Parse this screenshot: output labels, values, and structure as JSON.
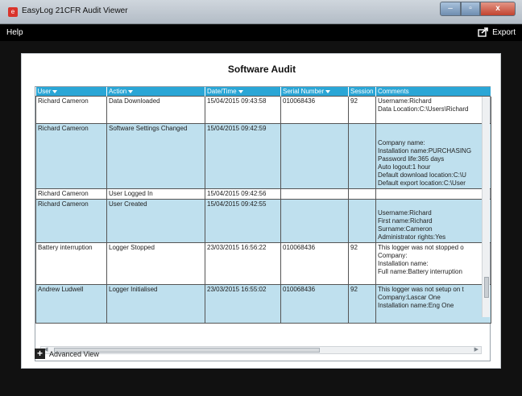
{
  "window": {
    "title": "EasyLog 21CFR Audit Viewer",
    "controls": {
      "minimize": "–",
      "maximize": "▫",
      "close": "x"
    }
  },
  "menu": {
    "help": "Help",
    "export": "Export"
  },
  "page": {
    "heading": "Software Audit",
    "advanced_view": "Advanced View"
  },
  "table": {
    "columns": [
      "User",
      "Action",
      "Date/Time",
      "Serial Number",
      "Session",
      "Comments"
    ],
    "rows": [
      {
        "highlight": false,
        "user": "Richard Cameron",
        "action": "Data Downloaded",
        "datetime": "15/04/2015 09:43:58",
        "serial": "010068436",
        "session": "92",
        "comments": [
          "Username:Richard",
          "Data Location:C:\\Users\\Richard"
        ]
      },
      {
        "highlight": true,
        "user": "Richard Cameron",
        "action": "Software Settings Changed",
        "datetime": "15/04/2015 09:42:59",
        "serial": "",
        "session": "",
        "comments": [
          "Company name:",
          "Installation name:PURCHASING",
          "Password life:365 days",
          "Auto logout:1 hour",
          "Default download location:C:\\U",
          "Default export location:C:\\User"
        ]
      },
      {
        "highlight": false,
        "user": "Richard Cameron",
        "action": "User Logged In",
        "datetime": "15/04/2015 09:42:56",
        "serial": "",
        "session": "",
        "comments": []
      },
      {
        "highlight": true,
        "user": "Richard Cameron",
        "action": "User Created",
        "datetime": "15/04/2015 09:42:55",
        "serial": "",
        "session": "",
        "comments": [
          "Username:Richard",
          "First name:Richard",
          "Surname:Cameron",
          "Administrator rights:Yes"
        ]
      },
      {
        "highlight": false,
        "user": "Battery interruption",
        "action": "Logger Stopped",
        "datetime": "23/03/2015 16:56:22",
        "serial": "010068436",
        "session": "92",
        "comments": [
          "This logger was not stopped o",
          "Company:",
          "Installation name:",
          "Full name:Battery interruption"
        ]
      },
      {
        "highlight": true,
        "user": "Andrew Ludwell",
        "action": "Logger Initialised",
        "datetime": "23/03/2015 16:55:02",
        "serial": "010068436",
        "session": "92",
        "comments": [
          "This logger was not setup on t",
          "Company:Lascar One",
          "Installation name:Eng One"
        ]
      }
    ]
  },
  "colors": {
    "header": "#2aa6d6",
    "highlight_row": "#bfe0ee",
    "close_button": "#c2432f"
  },
  "icons": {
    "app": "easylog-app-icon",
    "export": "export-icon",
    "filter": "filter-icon",
    "advanced": "plus-icon"
  }
}
